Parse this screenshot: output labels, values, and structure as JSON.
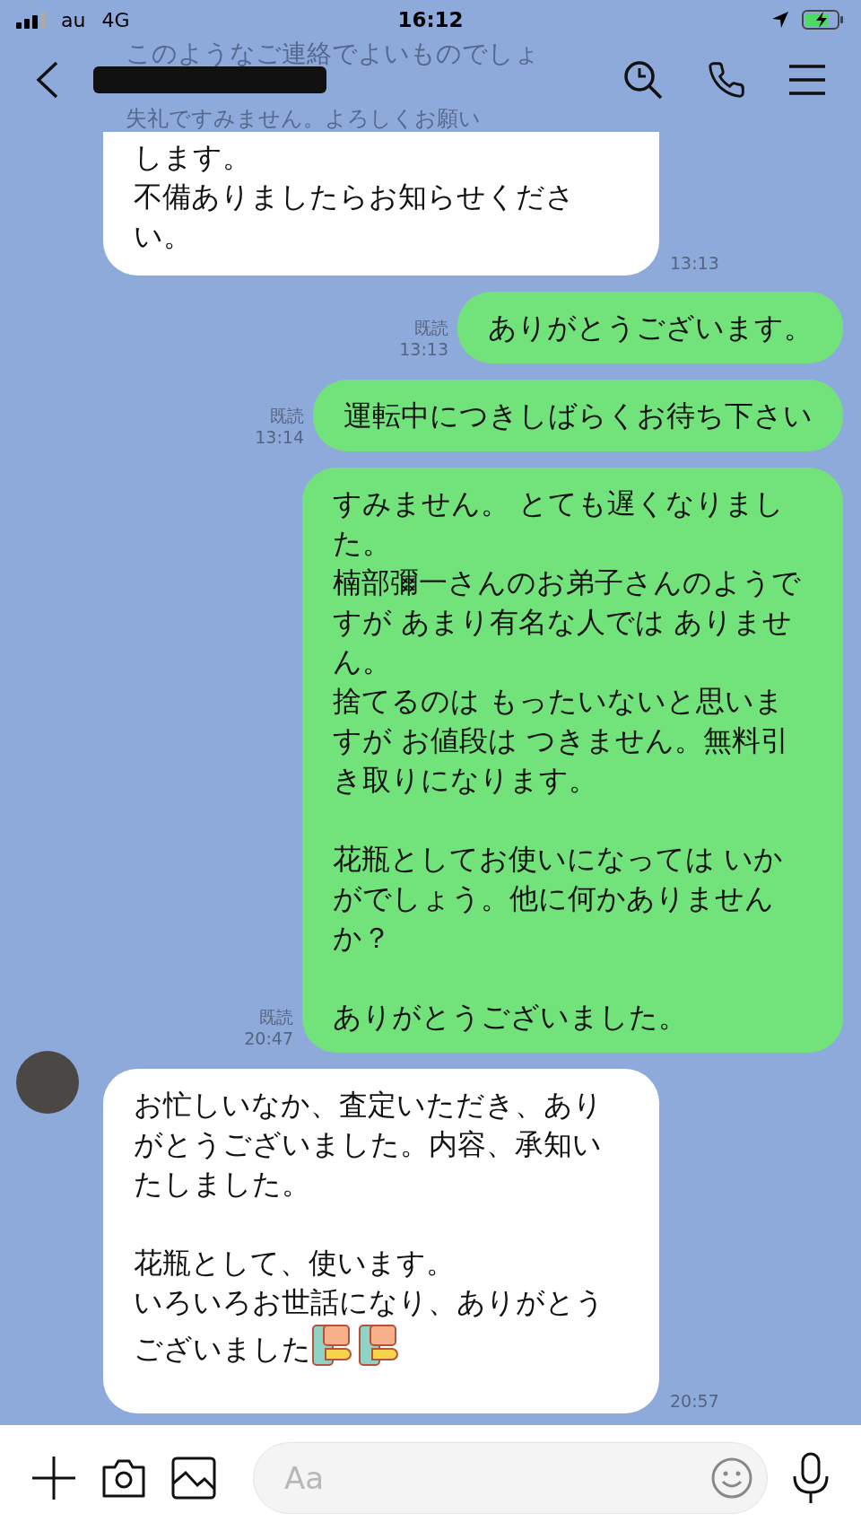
{
  "status_bar": {
    "carrier": "au",
    "network": "4G",
    "time": "16:12"
  },
  "header": {
    "hidden_lines": [
      "このようなご連絡でよいものでしょ",
      "失礼ですみません。よろしくお願い"
    ]
  },
  "messages": [
    {
      "kind": "incoming",
      "paragraphs": [
        [
          "します。",
          "不備ありましたらお知らせください。"
        ]
      ],
      "time": "13:13"
    },
    {
      "kind": "outgoing",
      "paragraphs": [
        [
          "ありがとうございます。"
        ]
      ],
      "read": "既読",
      "time": "13:13"
    },
    {
      "kind": "outgoing",
      "paragraphs": [
        [
          "運転中につきしばらくお待ち下さい"
        ]
      ],
      "read": "既読",
      "time": "13:14"
    },
    {
      "kind": "outgoing",
      "paragraphs": [
        [
          "すみません。 とても遅くなりました。",
          "楠部彌一さんのお弟子さんのようですが あまり有名な人では ありません。",
          "捨てるのは もったいないと思いますが お値段は つきません。無料引き取りになります。"
        ],
        [
          "花瓶としてお使いになっては いかがでしょう。他に何かありませんか？"
        ],
        [
          "ありがとうございました。"
        ]
      ],
      "read": "既読",
      "time": "20:47"
    },
    {
      "kind": "incoming",
      "avatar": true,
      "paragraphs": [
        [
          "お忙しいなか、査定いただき、ありがとうございました。内容、承知いたしました。"
        ],
        [
          "花瓶として、使います。",
          "いろいろお世話になり、ありがとうございました"
        ]
      ],
      "stickers": [
        {
          "kind": "bowing"
        },
        {
          "kind": "bowing"
        }
      ],
      "time": "20:57"
    }
  ],
  "input": {
    "placeholder": "Aa"
  }
}
